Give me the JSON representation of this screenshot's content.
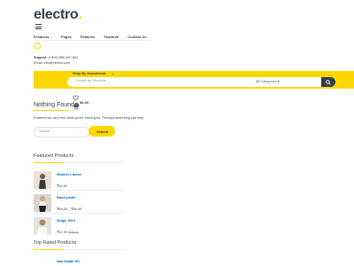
{
  "header": {
    "logo_text": "electro",
    "logo_dot": ".",
    "nav": [
      "Products",
      "Pages",
      "Features",
      "Featured",
      "Contact Us"
    ],
    "support_label": "Support",
    "support_phone": ": (+800) 856 800 604",
    "email": "Email: info@electro.com"
  },
  "searchbar": {
    "department_label": "Shop By Department",
    "placeholder": "Search for Products",
    "category": "All Categories",
    "category_caret": "▾"
  },
  "cart": {
    "count": "0",
    "total": "$0.00"
  },
  "main": {
    "title": "Nothing Found",
    "message": "It seems we can't find what you're looking for. Perhaps searching can help.",
    "search_placeholder": "Search ...",
    "search_button": "Search"
  },
  "featured": {
    "title": "Featured Products",
    "items": [
      {
        "name": "Women's dress",
        "price": "₹20.00",
        "old_price": ""
      },
      {
        "name": "Black pants",
        "price": "₹69.00 – ₹88.00",
        "old_price": ""
      },
      {
        "name": "Single Shirt",
        "price": "₹22.00",
        "old_price": "₹35.00"
      }
    ]
  },
  "top_rated": {
    "title": "Top Rated Products",
    "first_item": "Nail Health Kit"
  },
  "colors": {
    "accent": "#fed700",
    "text": "#333e48",
    "link": "#0062bd"
  }
}
